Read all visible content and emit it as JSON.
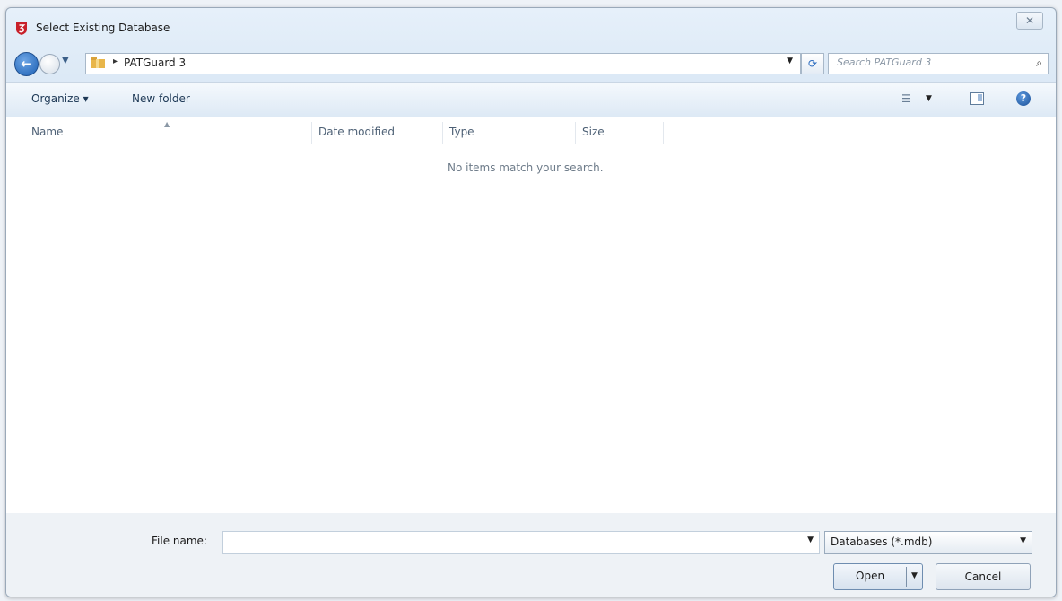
{
  "window": {
    "title": "Select Existing Database",
    "close_symbol": "✕"
  },
  "nav": {
    "back_symbol": "←",
    "breadcrumb": "PATGuard 3",
    "search_placeholder": "Search PATGuard 3"
  },
  "toolbar": {
    "organize_label": "Organize ▾",
    "new_folder_label": "New folder"
  },
  "columns": [
    "Name",
    "Date modified",
    "Type",
    "Size"
  ],
  "empty_message": "No items match your search.",
  "footer": {
    "file_name_label": "File name:",
    "file_name_value": "",
    "file_type_value": "Databases (*.mdb)",
    "open_label": "Open",
    "cancel_label": "Cancel"
  },
  "colors": {
    "app_icon": "#c8202a",
    "back_button": "#1b5fb3",
    "folder": "#e8b64a"
  }
}
